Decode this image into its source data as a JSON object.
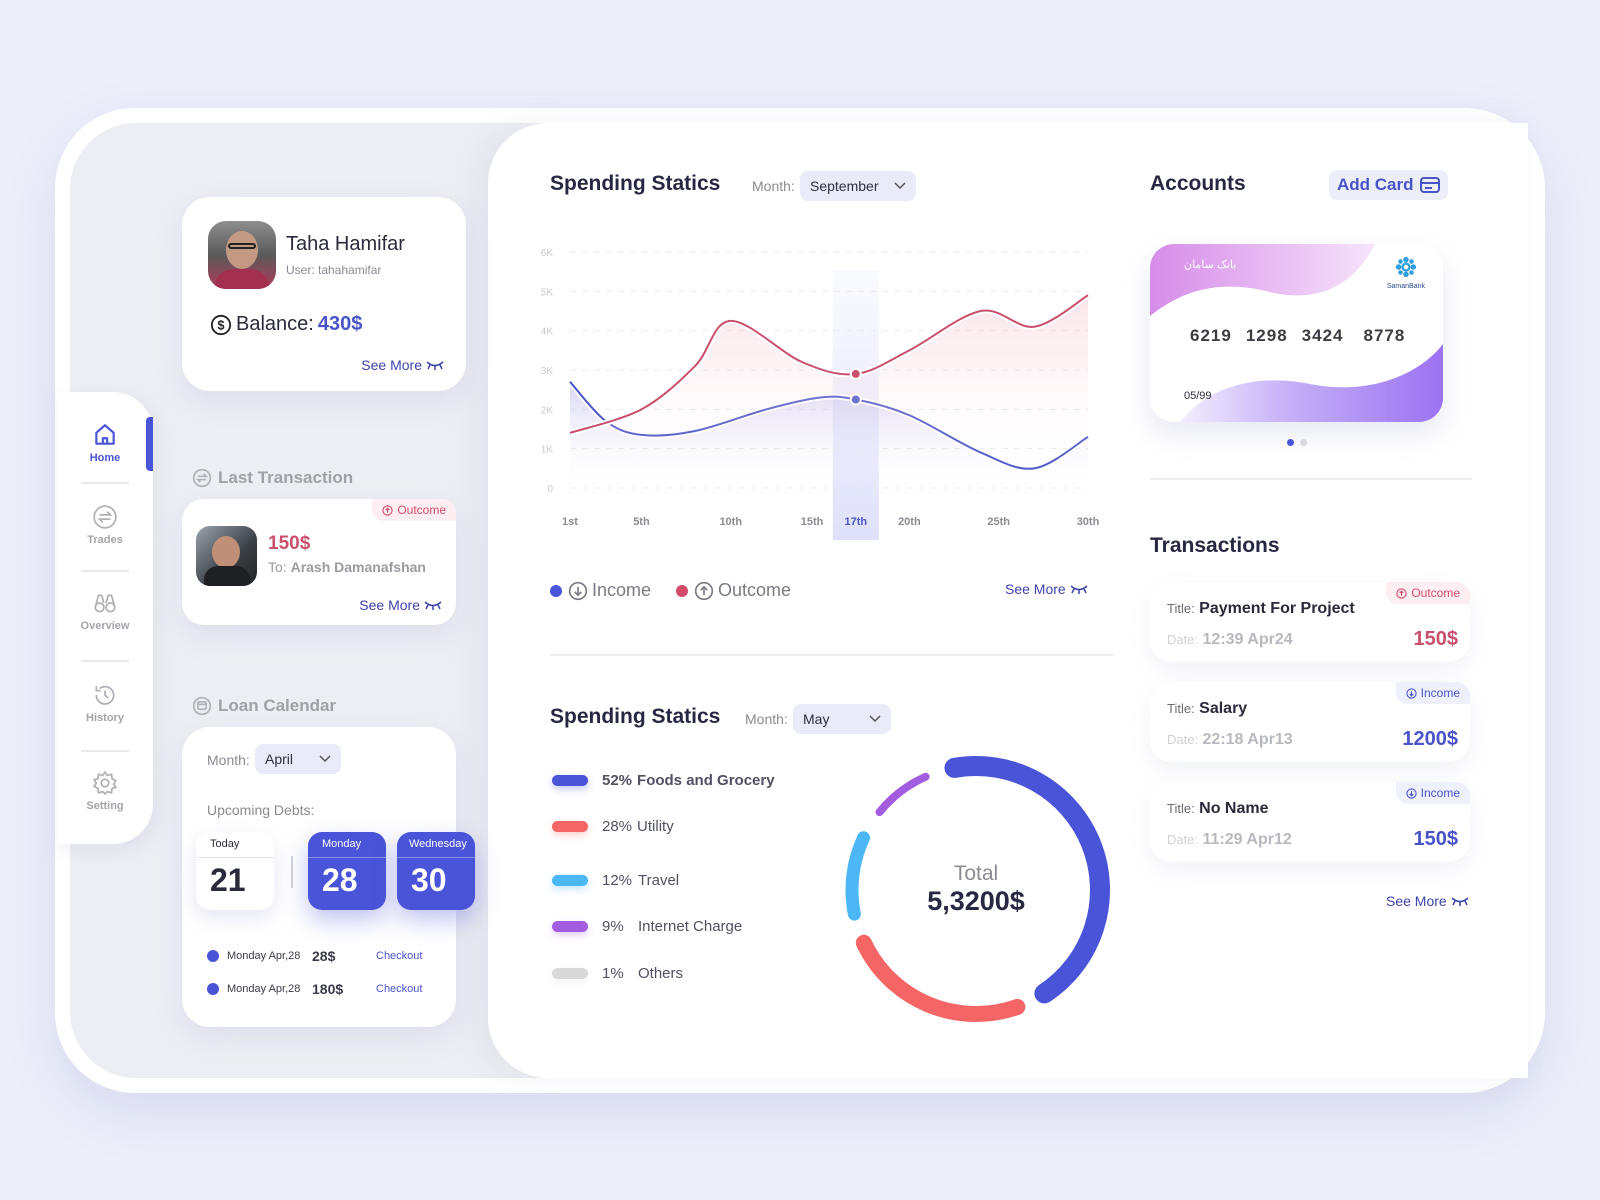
{
  "sidebar": {
    "items": [
      {
        "label": "Home",
        "icon": "home-icon",
        "active": true
      },
      {
        "label": "Trades",
        "icon": "swap-icon",
        "active": false
      },
      {
        "label": "Overview",
        "icon": "binoculars-icon",
        "active": false
      },
      {
        "label": "History",
        "icon": "history-icon",
        "active": false
      },
      {
        "label": "Setting",
        "icon": "gear-icon",
        "active": false
      }
    ]
  },
  "profile": {
    "name": "Taha Hamifar",
    "username": "User: tahahamifar",
    "balance_label": "Balance:",
    "balance_value": "430$",
    "see_more": "See More"
  },
  "last_transaction": {
    "title": "Last Transaction",
    "badge": "Outcome",
    "amount": "150$",
    "to_label": "To:",
    "to_name": "Arash Damanafshan",
    "see_more": "See More"
  },
  "loan_calendar": {
    "title": "Loan Calendar",
    "month_label": "Month:",
    "month_value": "April",
    "upcoming_label": "Upcoming Debts:",
    "days": [
      {
        "name": "Today",
        "date": "21",
        "highlight": false
      },
      {
        "name": "Monday",
        "date": "28",
        "highlight": true
      },
      {
        "name": "Wednesday",
        "date": "30",
        "highlight": true
      }
    ],
    "debts": [
      {
        "date": "Monday Apr,28",
        "amount": "28$",
        "action": "Checkout"
      },
      {
        "date": "Monday Apr,28",
        "amount": "180$",
        "action": "Checkout"
      }
    ]
  },
  "spending_line": {
    "title": "Spending Statics",
    "month_label": "Month:",
    "month_value": "September",
    "legend_income": "Income",
    "legend_outcome": "Outcome",
    "see_more": "See More"
  },
  "spending_donut": {
    "title": "Spending Statics",
    "month_label": "Month:",
    "month_value": "May",
    "total_label": "Total",
    "total_value": "5,3200$"
  },
  "accounts": {
    "title": "Accounts",
    "add_card": "Add Card",
    "card_number": [
      "6219",
      "1298",
      "3424",
      "8778"
    ],
    "card_expiry": "05/99",
    "bank_name": "SamanBank",
    "bank_name_fa": "بانک سامان",
    "pages": 2,
    "active_page": 1
  },
  "transactions": {
    "title": "Transactions",
    "title_label": "Title:",
    "date_label": "Date:",
    "items": [
      {
        "title": "Payment For Project",
        "date": "12:39  Apr24",
        "amount": "150$",
        "type": "Outcome"
      },
      {
        "title": "Salary",
        "date": "22:18  Apr13",
        "amount": "1200$",
        "type": "Income"
      },
      {
        "title": "No Name",
        "date": "11:29  Apr12",
        "amount": "150$",
        "type": "Income"
      }
    ],
    "see_more": "See More"
  },
  "colors": {
    "accent": "#4a54d8",
    "outcome": "#d34b6a",
    "income": "#4a54d8",
    "background": "#eceef9"
  },
  "chart_data": [
    {
      "type": "line",
      "title": "Spending Statics",
      "x": [
        "1st",
        "5th",
        "10th",
        "15th",
        "17th",
        "20th",
        "25th",
        "30th"
      ],
      "x_days": [
        1,
        5,
        10,
        15,
        17,
        20,
        25,
        30
      ],
      "y_ticks": [
        "0",
        "1K",
        "2K",
        "3K",
        "4K",
        "5K",
        "6K"
      ],
      "ylim": [
        0,
        6000
      ],
      "highlight_x": "17th",
      "grid": true,
      "series": [
        {
          "name": "Income",
          "color": "#4a54c8",
          "points": [
            [
              1,
              2700
            ],
            [
              3,
              1700
            ],
            [
              5,
              1350
            ],
            [
              8,
              1450
            ],
            [
              12,
              2000
            ],
            [
              15,
              2300
            ],
            [
              17,
              2250
            ],
            [
              20,
              1850
            ],
            [
              24,
              900
            ],
            [
              27,
              500
            ],
            [
              30,
              1300
            ]
          ]
        },
        {
          "name": "Outcome",
          "color": "#c9506c",
          "points": [
            [
              1,
              1400
            ],
            [
              5,
              2000
            ],
            [
              8,
              3100
            ],
            [
              10,
              4250
            ],
            [
              14,
              3200
            ],
            [
              17,
              2900
            ],
            [
              20,
              3500
            ],
            [
              24,
              4500
            ],
            [
              27,
              4100
            ],
            [
              30,
              4900
            ]
          ]
        }
      ],
      "legend": [
        "Income",
        "Outcome"
      ]
    },
    {
      "type": "pie",
      "title": "Spending Statics",
      "categories": [
        "Foods and Grocery",
        "Utility",
        "Travel",
        "Internet Charge",
        "Others"
      ],
      "values": [
        52,
        28,
        12,
        9,
        1
      ],
      "labels": [
        "52%",
        "28%",
        "12%",
        "9%",
        "1%"
      ],
      "colors": [
        "#4a54d8",
        "#f56565",
        "#4bb8f5",
        "#a15ce0",
        "#d9d9d9"
      ],
      "center_label": "Total",
      "center_value": "5,3200$"
    }
  ]
}
